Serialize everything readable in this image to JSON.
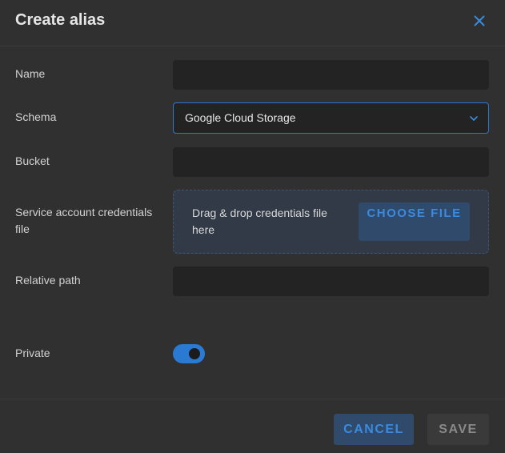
{
  "dialog": {
    "title": "Create alias"
  },
  "form": {
    "name_label": "Name",
    "name_value": "",
    "schema_label": "Schema",
    "schema_value": "Google Cloud Storage",
    "bucket_label": "Bucket",
    "bucket_value": "",
    "credentials_label": "Service account credentials file",
    "dropzone_text": "Drag & drop credentials file here",
    "choose_file_label": "CHOOSE FILE",
    "relative_path_label": "Relative path",
    "relative_path_value": "",
    "private_label": "Private",
    "private_enabled": true
  },
  "footer": {
    "cancel_label": "CANCEL",
    "save_label": "SAVE"
  },
  "icons": {
    "close": "close-icon",
    "dropdown": "chevron-down-icon"
  },
  "colors": {
    "background": "#303030",
    "accent": "#2a7ad4",
    "accent_text": "#3b8ae0",
    "input_bg": "#232323",
    "dropzone_bg": "#313a46"
  }
}
